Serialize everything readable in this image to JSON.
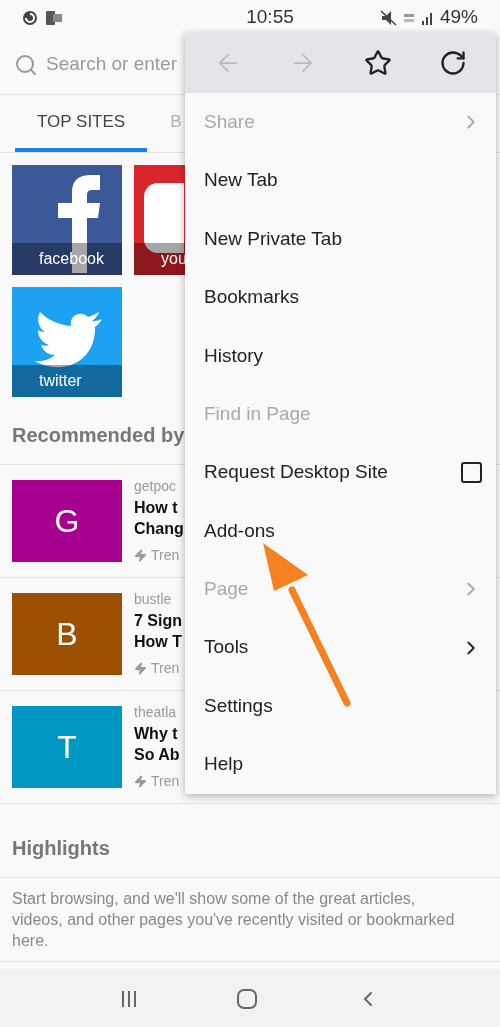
{
  "status_bar": {
    "time": "10:55",
    "battery": "49%"
  },
  "search": {
    "placeholder": "Search or enter"
  },
  "tabs": [
    {
      "label": "TOP SITES",
      "selected": true
    },
    {
      "label": "B",
      "selected": false
    }
  ],
  "top_sites": [
    {
      "label": "facebook",
      "kind": "f",
      "color": "#3b5998"
    },
    {
      "label": "you",
      "kind": "play",
      "color": "#d8262c"
    },
    {
      "label": "twitter",
      "kind": "bird",
      "color": "#1da1f2"
    }
  ],
  "recommended": {
    "title": "Recommended by",
    "cards": [
      {
        "letter": "G",
        "color": "#a7008e",
        "source": "getpoc",
        "lines": [
          "How t",
          "Chang"
        ],
        "tag": "Tren"
      },
      {
        "letter": "B",
        "color": "#9b4f00",
        "source": "bustle",
        "lines": [
          "7 Sign",
          "How T"
        ],
        "tag": "Tren"
      },
      {
        "letter": "T",
        "color": "#0098c2",
        "source": "theatla",
        "lines": [
          "Why t",
          "So Ab"
        ],
        "tag": "Tren"
      }
    ]
  },
  "highlights": {
    "title": "Highlights",
    "text": "Start browsing, and we'll show some of the great articles, videos, and other pages you've recently visited or bookmarked here."
  },
  "menu": {
    "toolbar": [
      {
        "kind": "back",
        "disabled": true
      },
      {
        "kind": "forward",
        "disabled": true
      },
      {
        "kind": "star",
        "disabled": false
      },
      {
        "kind": "reload",
        "disabled": false
      }
    ],
    "items": [
      {
        "label": "Share",
        "kind": "submenu",
        "disabled": true
      },
      {
        "label": "New Tab",
        "kind": "plain",
        "disabled": false
      },
      {
        "label": "New Private Tab",
        "kind": "plain",
        "disabled": false
      },
      {
        "label": "Bookmarks",
        "kind": "plain",
        "disabled": false
      },
      {
        "label": "History",
        "kind": "plain",
        "disabled": false
      },
      {
        "label": "Find in Page",
        "kind": "plain",
        "disabled": true
      },
      {
        "label": "Request Desktop Site",
        "kind": "checkbox",
        "disabled": false,
        "checked": false
      },
      {
        "label": "Add-ons",
        "kind": "plain",
        "disabled": false
      },
      {
        "label": "Page",
        "kind": "submenu",
        "disabled": true
      },
      {
        "label": "Tools",
        "kind": "submenu",
        "disabled": false
      },
      {
        "label": "Settings",
        "kind": "plain",
        "disabled": false
      },
      {
        "label": "Help",
        "kind": "plain",
        "disabled": false
      }
    ]
  }
}
